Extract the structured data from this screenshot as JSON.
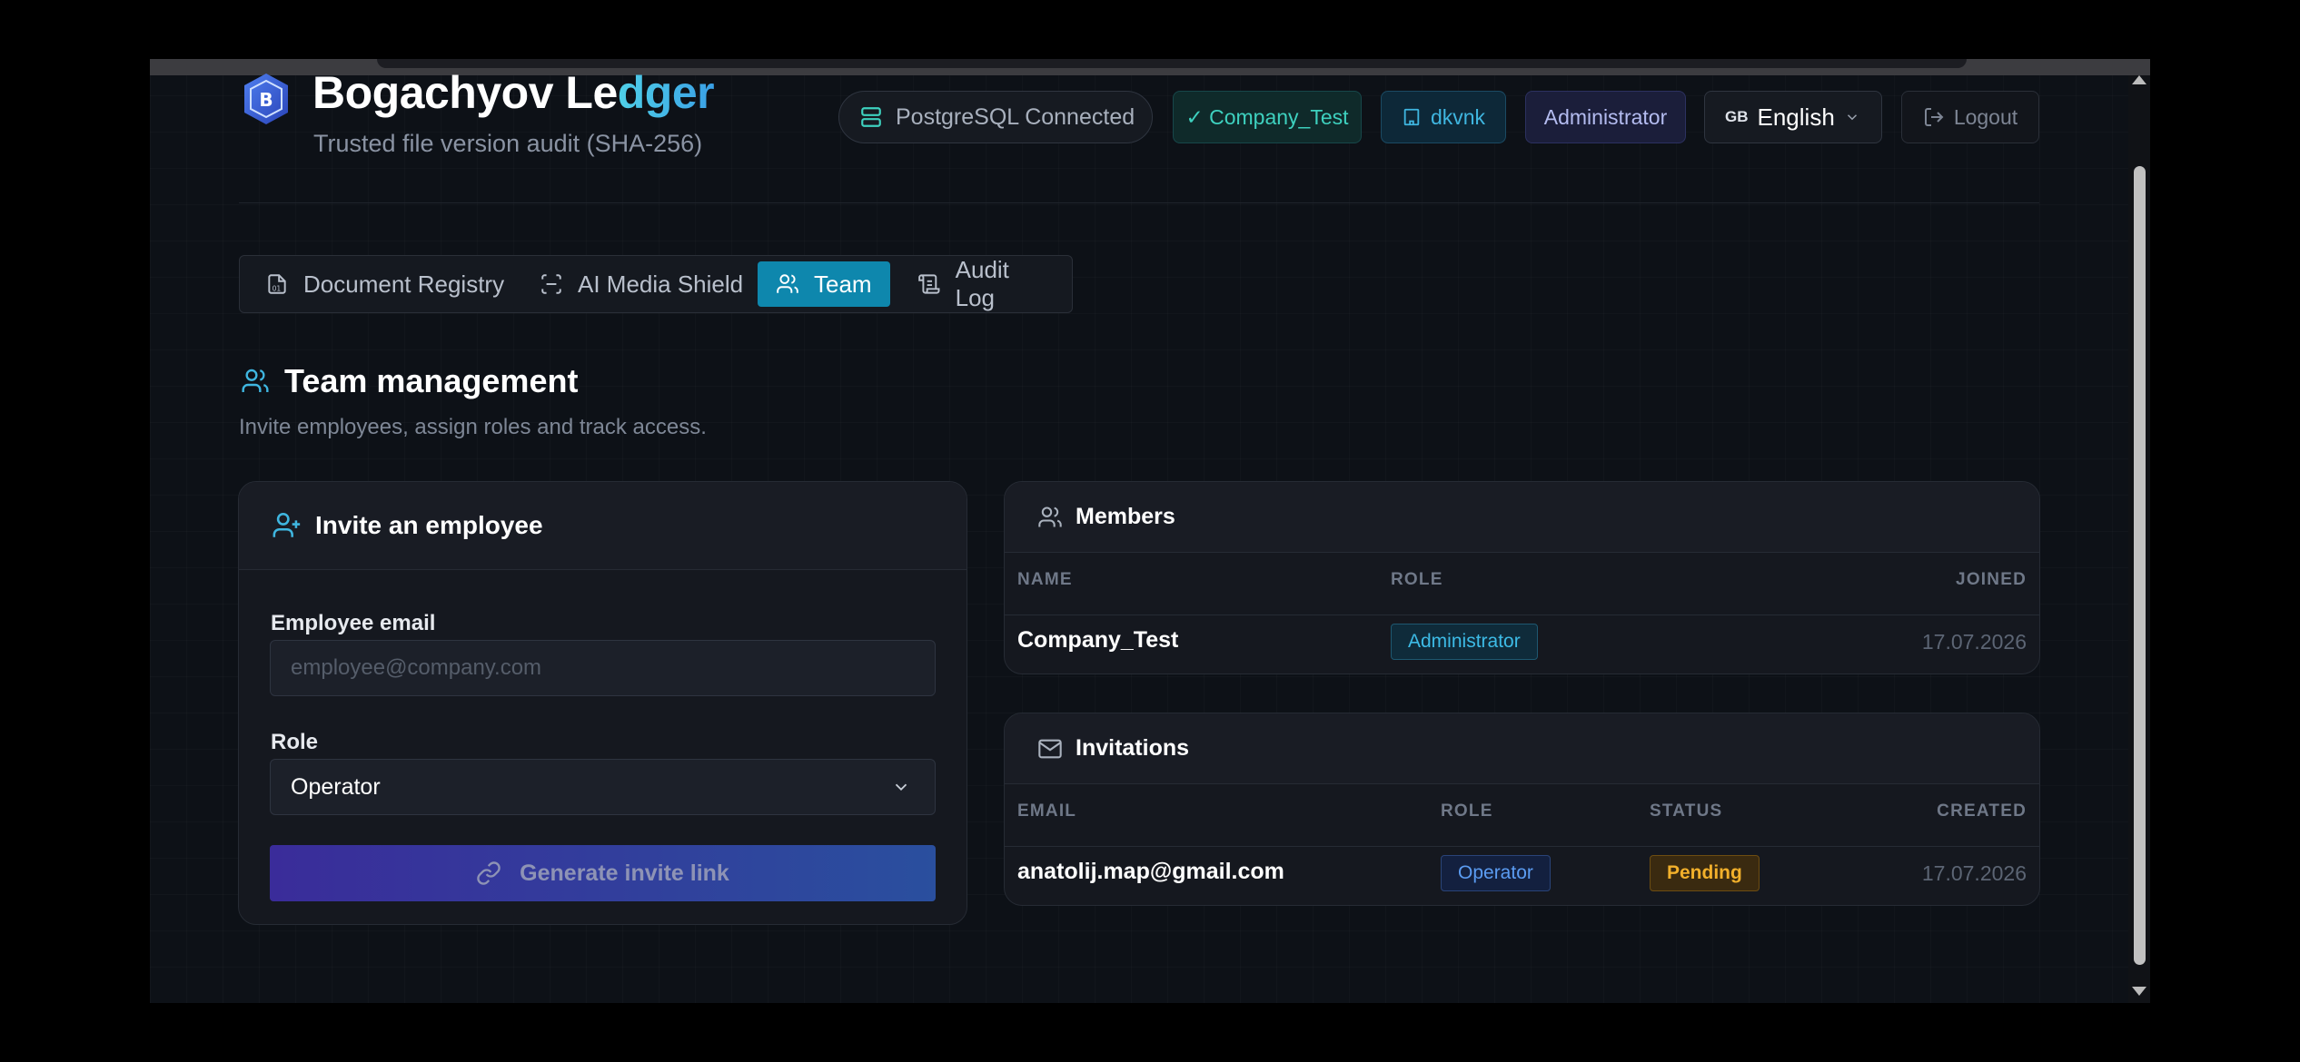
{
  "app": {
    "title_main": "Bogachyov Le",
    "title_accent": "dger",
    "subtitle": "Trusted file version audit (SHA-256)",
    "logo_letter": "B"
  },
  "header": {
    "db_status": "PostgreSQL Connected",
    "company": "✓ Company_Test",
    "user": "dkvnk",
    "role": "Administrator",
    "lang_flag": "GB",
    "language": "English",
    "logout": "Logout"
  },
  "tabs": [
    {
      "label": "Document Registry",
      "icon": "document-icon"
    },
    {
      "label": "AI Media Shield",
      "icon": "scan-icon"
    },
    {
      "label": "Team",
      "icon": "users-icon",
      "active": true
    },
    {
      "label": "Audit Log",
      "icon": "scroll-icon"
    }
  ],
  "section": {
    "title": "Team management",
    "subtitle": "Invite employees, assign roles and track access."
  },
  "invite_form": {
    "title": "Invite an employee",
    "email_label": "Employee email",
    "email_placeholder": "employee@company.com",
    "role_label": "Role",
    "role_value": "Operator",
    "submit": "Generate invite link"
  },
  "members": {
    "title": "Members",
    "columns": [
      "NAME",
      "ROLE",
      "JOINED"
    ],
    "rows": [
      {
        "name": "Company_Test",
        "role": "Administrator",
        "joined": "17.07.2026"
      }
    ]
  },
  "invitations": {
    "title": "Invitations",
    "columns": [
      "EMAIL",
      "ROLE",
      "STATUS",
      "CREATED"
    ],
    "rows": [
      {
        "email": "anatolij.map@gmail.com",
        "role": "Operator",
        "status": "Pending",
        "created": "17.07.2026"
      }
    ]
  },
  "colors": {
    "background": "#0d1117",
    "accent": "#0e87ad",
    "teal": "#3ed1bf",
    "pending": "#f2b02b"
  }
}
